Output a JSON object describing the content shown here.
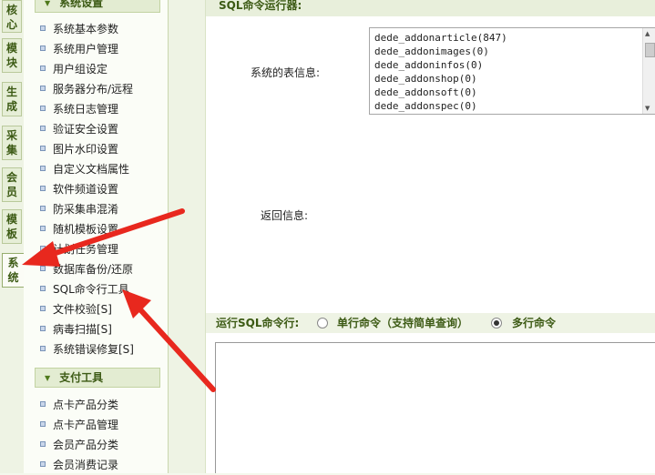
{
  "tabs": [
    {
      "label": "核心",
      "active": false
    },
    {
      "label": "模块",
      "active": false
    },
    {
      "label": "生成",
      "active": false
    },
    {
      "label": "采集",
      "active": false
    },
    {
      "label": "会员",
      "active": false
    },
    {
      "label": "模板",
      "active": false
    },
    {
      "label": "系统",
      "active": true
    }
  ],
  "menu": {
    "section1_title": "系统设置",
    "items": [
      "系统基本参数",
      "系统用户管理",
      "用户组设定",
      "服务器分布/远程",
      "系统日志管理",
      "验证安全设置",
      "图片水印设置",
      "自定义文档属性",
      "软件频道设置",
      "防采集串混淆",
      "随机模板设置",
      "计划任务管理",
      "数据库备份/还原",
      "SQL命令行工具",
      "文件校验[S]",
      "病毒扫描[S]",
      "系统错误修复[S]"
    ],
    "section2_title": "支付工具",
    "pay_items": [
      "点卡产品分类",
      "点卡产品管理",
      "会员产品分类",
      "会员消费记录"
    ]
  },
  "main": {
    "header": "SQL命令运行器:",
    "tables_label": "系统的表信息:",
    "tables": [
      "dede_addonarticle(847)",
      "dede_addonimages(0)",
      "dede_addoninfos(0)",
      "dede_addonshop(0)",
      "dede_addonsoft(0)",
      "dede_addonspec(0)"
    ],
    "return_label": "返回信息:",
    "run_label": "运行SQL命令行:",
    "option_single": "单行命令（支持简单查询）",
    "option_multi": "多行命令",
    "selected_option": "multi"
  },
  "colors": {
    "accent_green": "#3c5a14",
    "arrow_red": "#e8281e"
  }
}
